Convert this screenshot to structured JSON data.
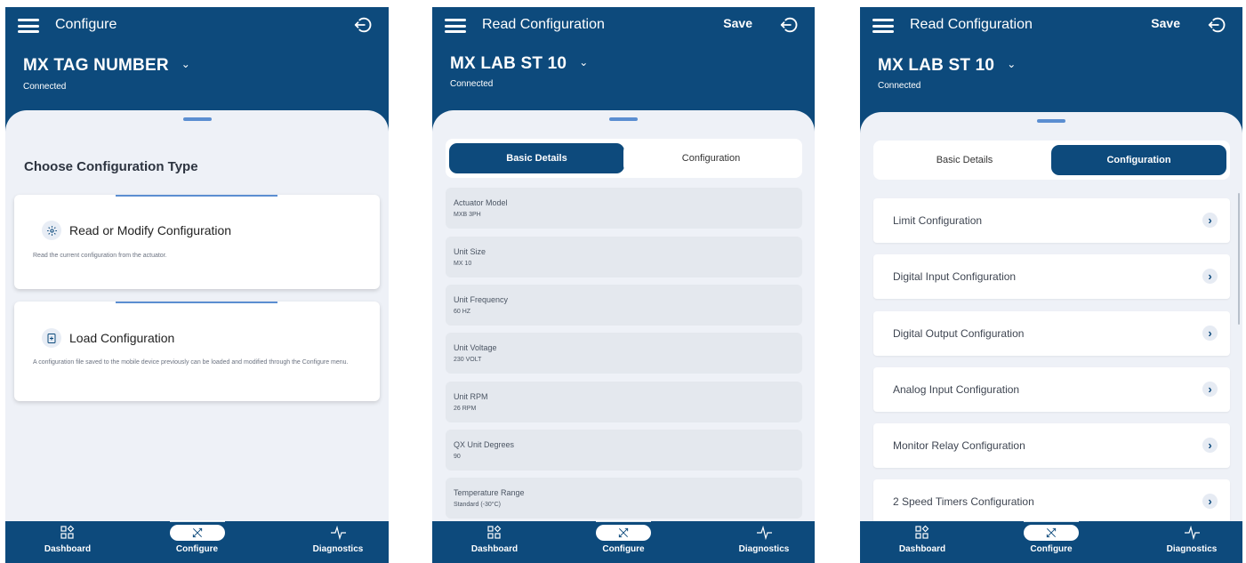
{
  "screens": [
    {
      "title": "Configure",
      "device_name": "MX TAG NUMBER",
      "status": "Connected",
      "section_title": "Choose Configuration Type",
      "cards": [
        {
          "title": "Read or Modify Configuration",
          "description": "Read the current configuration from the actuator.",
          "icon": "gear-icon"
        },
        {
          "title": "Load Configuration",
          "description": "A configuration file saved to the mobile device previously can be loaded and modified through the Configure menu.",
          "icon": "file-add-icon"
        }
      ]
    },
    {
      "title": "Read Configuration",
      "save_label": "Save",
      "device_name": "MX LAB ST 10",
      "status": "Connected",
      "tabs": [
        "Basic Details",
        "Configuration"
      ],
      "active_tab": "Basic Details",
      "fields": [
        {
          "label": "Actuator Model",
          "value": "MXB 3PH"
        },
        {
          "label": "Unit Size",
          "value": "MX 10"
        },
        {
          "label": "Unit Frequency",
          "value": "60 HZ"
        },
        {
          "label": "Unit Voltage",
          "value": "230 VOLT"
        },
        {
          "label": "Unit RPM",
          "value": "26 RPM"
        },
        {
          "label": "QX Unit Degrees",
          "value": "90"
        },
        {
          "label": "Temperature Range",
          "value": "Standard (-30°C)"
        }
      ]
    },
    {
      "title": "Read Configuration",
      "save_label": "Save",
      "device_name": "MX LAB ST 10",
      "status": "Connected",
      "tabs": [
        "Basic Details",
        "Configuration"
      ],
      "active_tab": "Configuration",
      "items": [
        "Limit Configuration",
        "Digital Input Configuration",
        "Digital Output Configuration",
        "Analog Input Configuration",
        "Monitor Relay Configuration",
        "2 Speed Timers Configuration"
      ]
    }
  ],
  "bottom_nav": {
    "items": [
      {
        "label": "Dashboard",
        "icon": "dashboard-icon"
      },
      {
        "label": "Configure",
        "icon": "tools-icon"
      },
      {
        "label": "Diagnostics",
        "icon": "pulse-icon"
      }
    ],
    "active": "Configure"
  },
  "colors": {
    "brand": "#0d4a7c",
    "sheet": "#eef1f7",
    "accent": "#5b8ed1"
  }
}
